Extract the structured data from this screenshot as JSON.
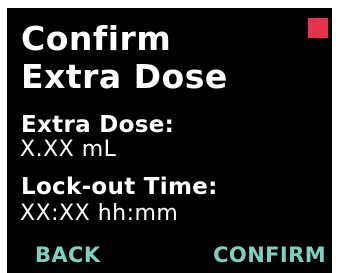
{
  "header": {
    "title_line1": "Confirm",
    "title_line2": "Extra Dose"
  },
  "status_indicator": {
    "color": "#e8334f"
  },
  "details": {
    "extra_dose_label": "Extra Dose:",
    "extra_dose_value": "X.XX mL",
    "lockout_label": "Lock-out Time:",
    "lockout_value": "XX:XX hh:mm"
  },
  "softkeys": {
    "back_label": "BACK",
    "confirm_label": "CONFIRM",
    "color": "#7fd0bf"
  }
}
